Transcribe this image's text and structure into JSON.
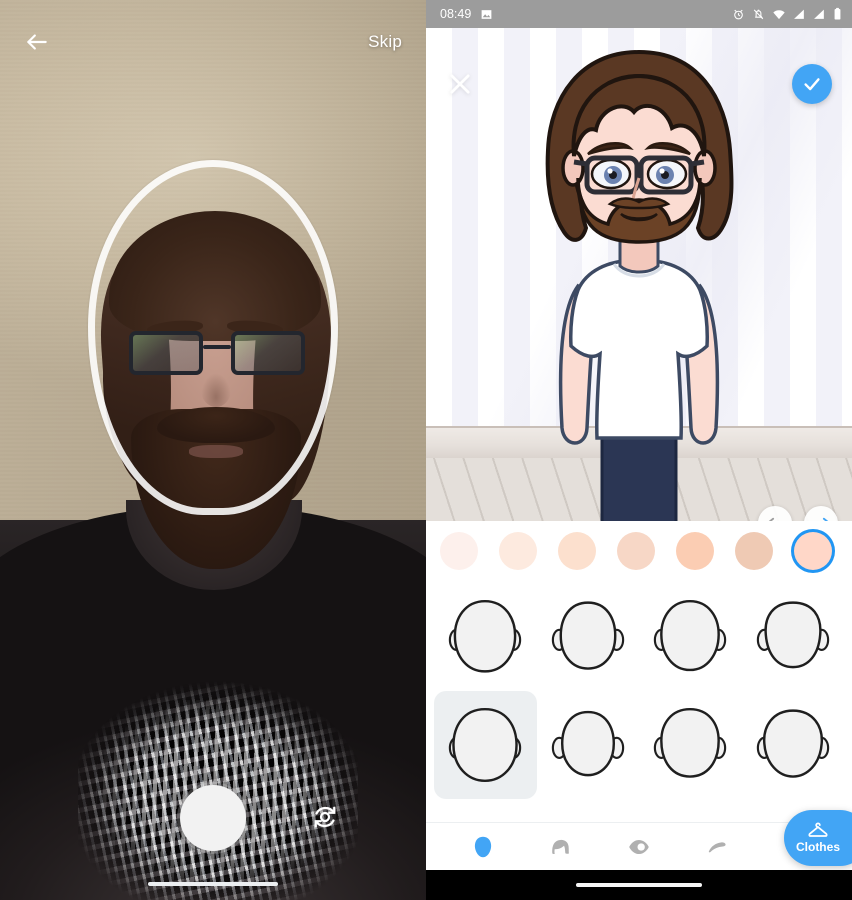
{
  "camera": {
    "back_icon": "arrow-left-icon",
    "skip_label": "Skip",
    "shutter_label": "shutter-button",
    "flip_icon": "camera-flip-icon",
    "oval_guide_label": "face-alignment-oval"
  },
  "status_bar": {
    "time": "08:49",
    "left_icons": [
      "image-icon"
    ],
    "right_icons": [
      "alarm-icon",
      "notifications-off-icon",
      "wifi-icon",
      "signal-icon",
      "signal-icon",
      "battery-icon"
    ],
    "background": "#9c9c9c"
  },
  "editor": {
    "close_icon": "close-icon",
    "confirm_icon": "check-icon",
    "confirm_color": "#42a5f5",
    "undo_icon": "undo-icon",
    "redo_icon": "redo-icon",
    "undo_enabled": false,
    "redo_enabled": true,
    "preview": {
      "background": "room-with-striped-wallpaper-and-wood-floor",
      "avatar": {
        "hair_color": "#5a3823",
        "skin_color": "#fbdcd2",
        "shirt_color": "#ffffff",
        "pants_color": "#2b3654",
        "has_glasses": true,
        "has_beard": true,
        "eye_color": "#6b82b0"
      }
    },
    "skin_tones": [
      {
        "color": "#fdf0ec",
        "selected": false
      },
      {
        "color": "#fdeadf",
        "selected": false
      },
      {
        "color": "#fce0ce",
        "selected": false
      },
      {
        "color": "#f7d7c6",
        "selected": false
      },
      {
        "color": "#fbcdb3",
        "selected": false
      },
      {
        "color": "#efcab4",
        "selected": false
      },
      {
        "color": "#ffd7c8",
        "selected": true
      },
      {
        "color": "#fbc6ae",
        "selected": false
      }
    ],
    "face_shapes": [
      {
        "id": "face-shape-1",
        "selected": false
      },
      {
        "id": "face-shape-2",
        "selected": false
      },
      {
        "id": "face-shape-3",
        "selected": false
      },
      {
        "id": "face-shape-4",
        "selected": false
      },
      {
        "id": "face-shape-5",
        "selected": true
      },
      {
        "id": "face-shape-6",
        "selected": false
      },
      {
        "id": "face-shape-7",
        "selected": false
      },
      {
        "id": "face-shape-8",
        "selected": false
      }
    ],
    "tabs": [
      {
        "id": "tab-face",
        "icon": "face-icon",
        "selected": true
      },
      {
        "id": "tab-hair",
        "icon": "hair-icon",
        "selected": false
      },
      {
        "id": "tab-eyes",
        "icon": "eye-icon",
        "selected": false
      },
      {
        "id": "tab-eyebrows",
        "icon": "eyebrow-icon",
        "selected": false
      },
      {
        "id": "tab-nose",
        "icon": "nose-icon",
        "selected": false
      }
    ],
    "tab_selected_color": "#42a5f5",
    "tab_inactive_color": "#b0b0b0",
    "clothes_button": {
      "label": "Clothes",
      "icon": "hanger-icon",
      "color": "#42a5f5"
    }
  }
}
